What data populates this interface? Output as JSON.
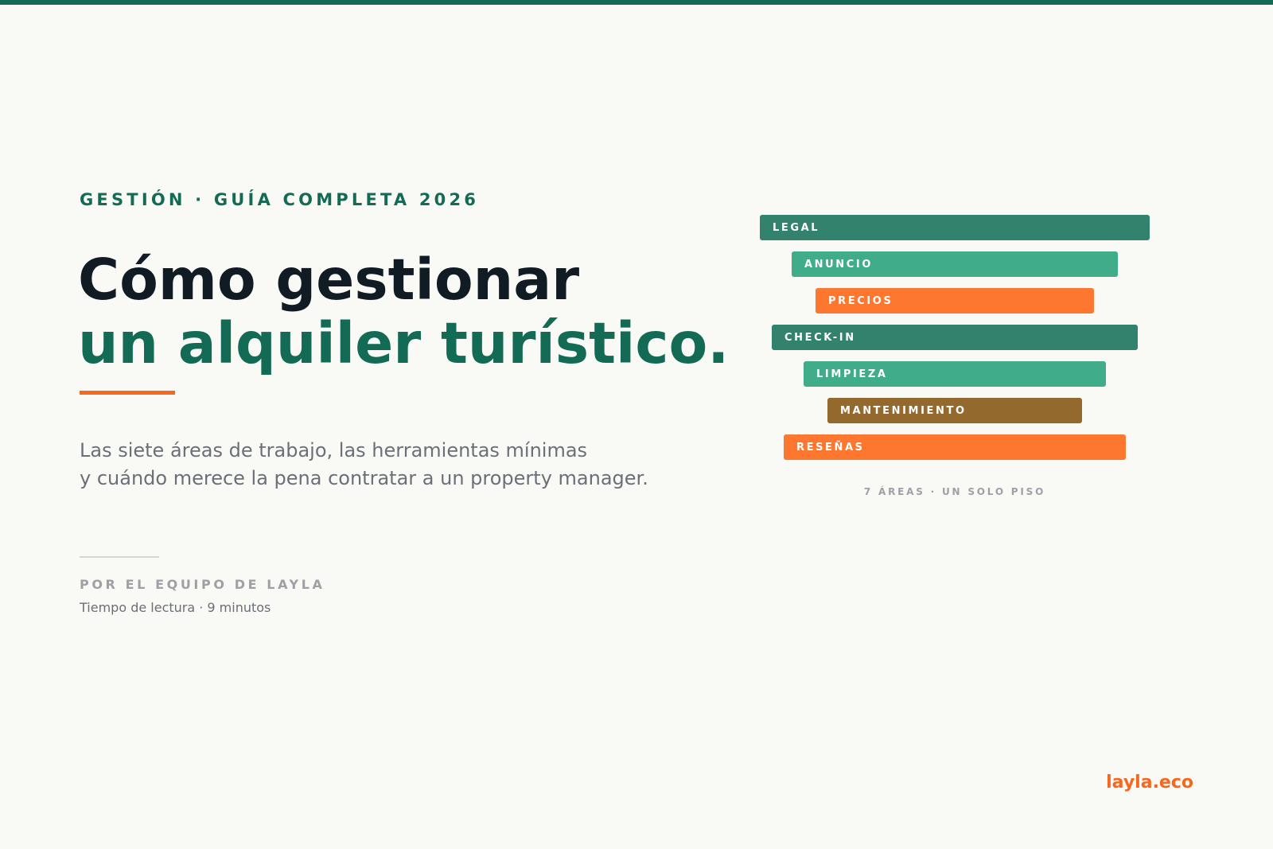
{
  "header": {
    "eyebrow": "GESTIÓN · GUÍA COMPLETA 2026",
    "title_line1": "Cómo gestionar",
    "title_line2": "un alquiler turístico.",
    "subtitle_line1": "Las siete áreas de trabajo, las herramientas mínimas",
    "subtitle_line2": "y cuándo merece la pena contratar a un property manager."
  },
  "byline": {
    "author": "POR EL EQUIPO DE LAYLA",
    "reading_time": "Tiempo de lectura · 9 minutos"
  },
  "areas": {
    "items": [
      {
        "label": "LEGAL",
        "color": "#32826e"
      },
      {
        "label": "ANUNCIO",
        "color": "#40ac89"
      },
      {
        "label": "PRECIOS",
        "color": "#fd772e"
      },
      {
        "label": "CHECK-IN",
        "color": "#32826e"
      },
      {
        "label": "LIMPIEZA",
        "color": "#40ac89"
      },
      {
        "label": "MANTENIMIENTO",
        "color": "#94692e"
      },
      {
        "label": "RESEÑAS",
        "color": "#fd772e"
      }
    ],
    "caption": "7 ÁREAS · UN SOLO PISO"
  },
  "footer": {
    "brand": "layla.eco"
  },
  "colors": {
    "accent_green": "#146b55",
    "accent_orange": "#f4681f",
    "background": "#f9f9f6"
  }
}
